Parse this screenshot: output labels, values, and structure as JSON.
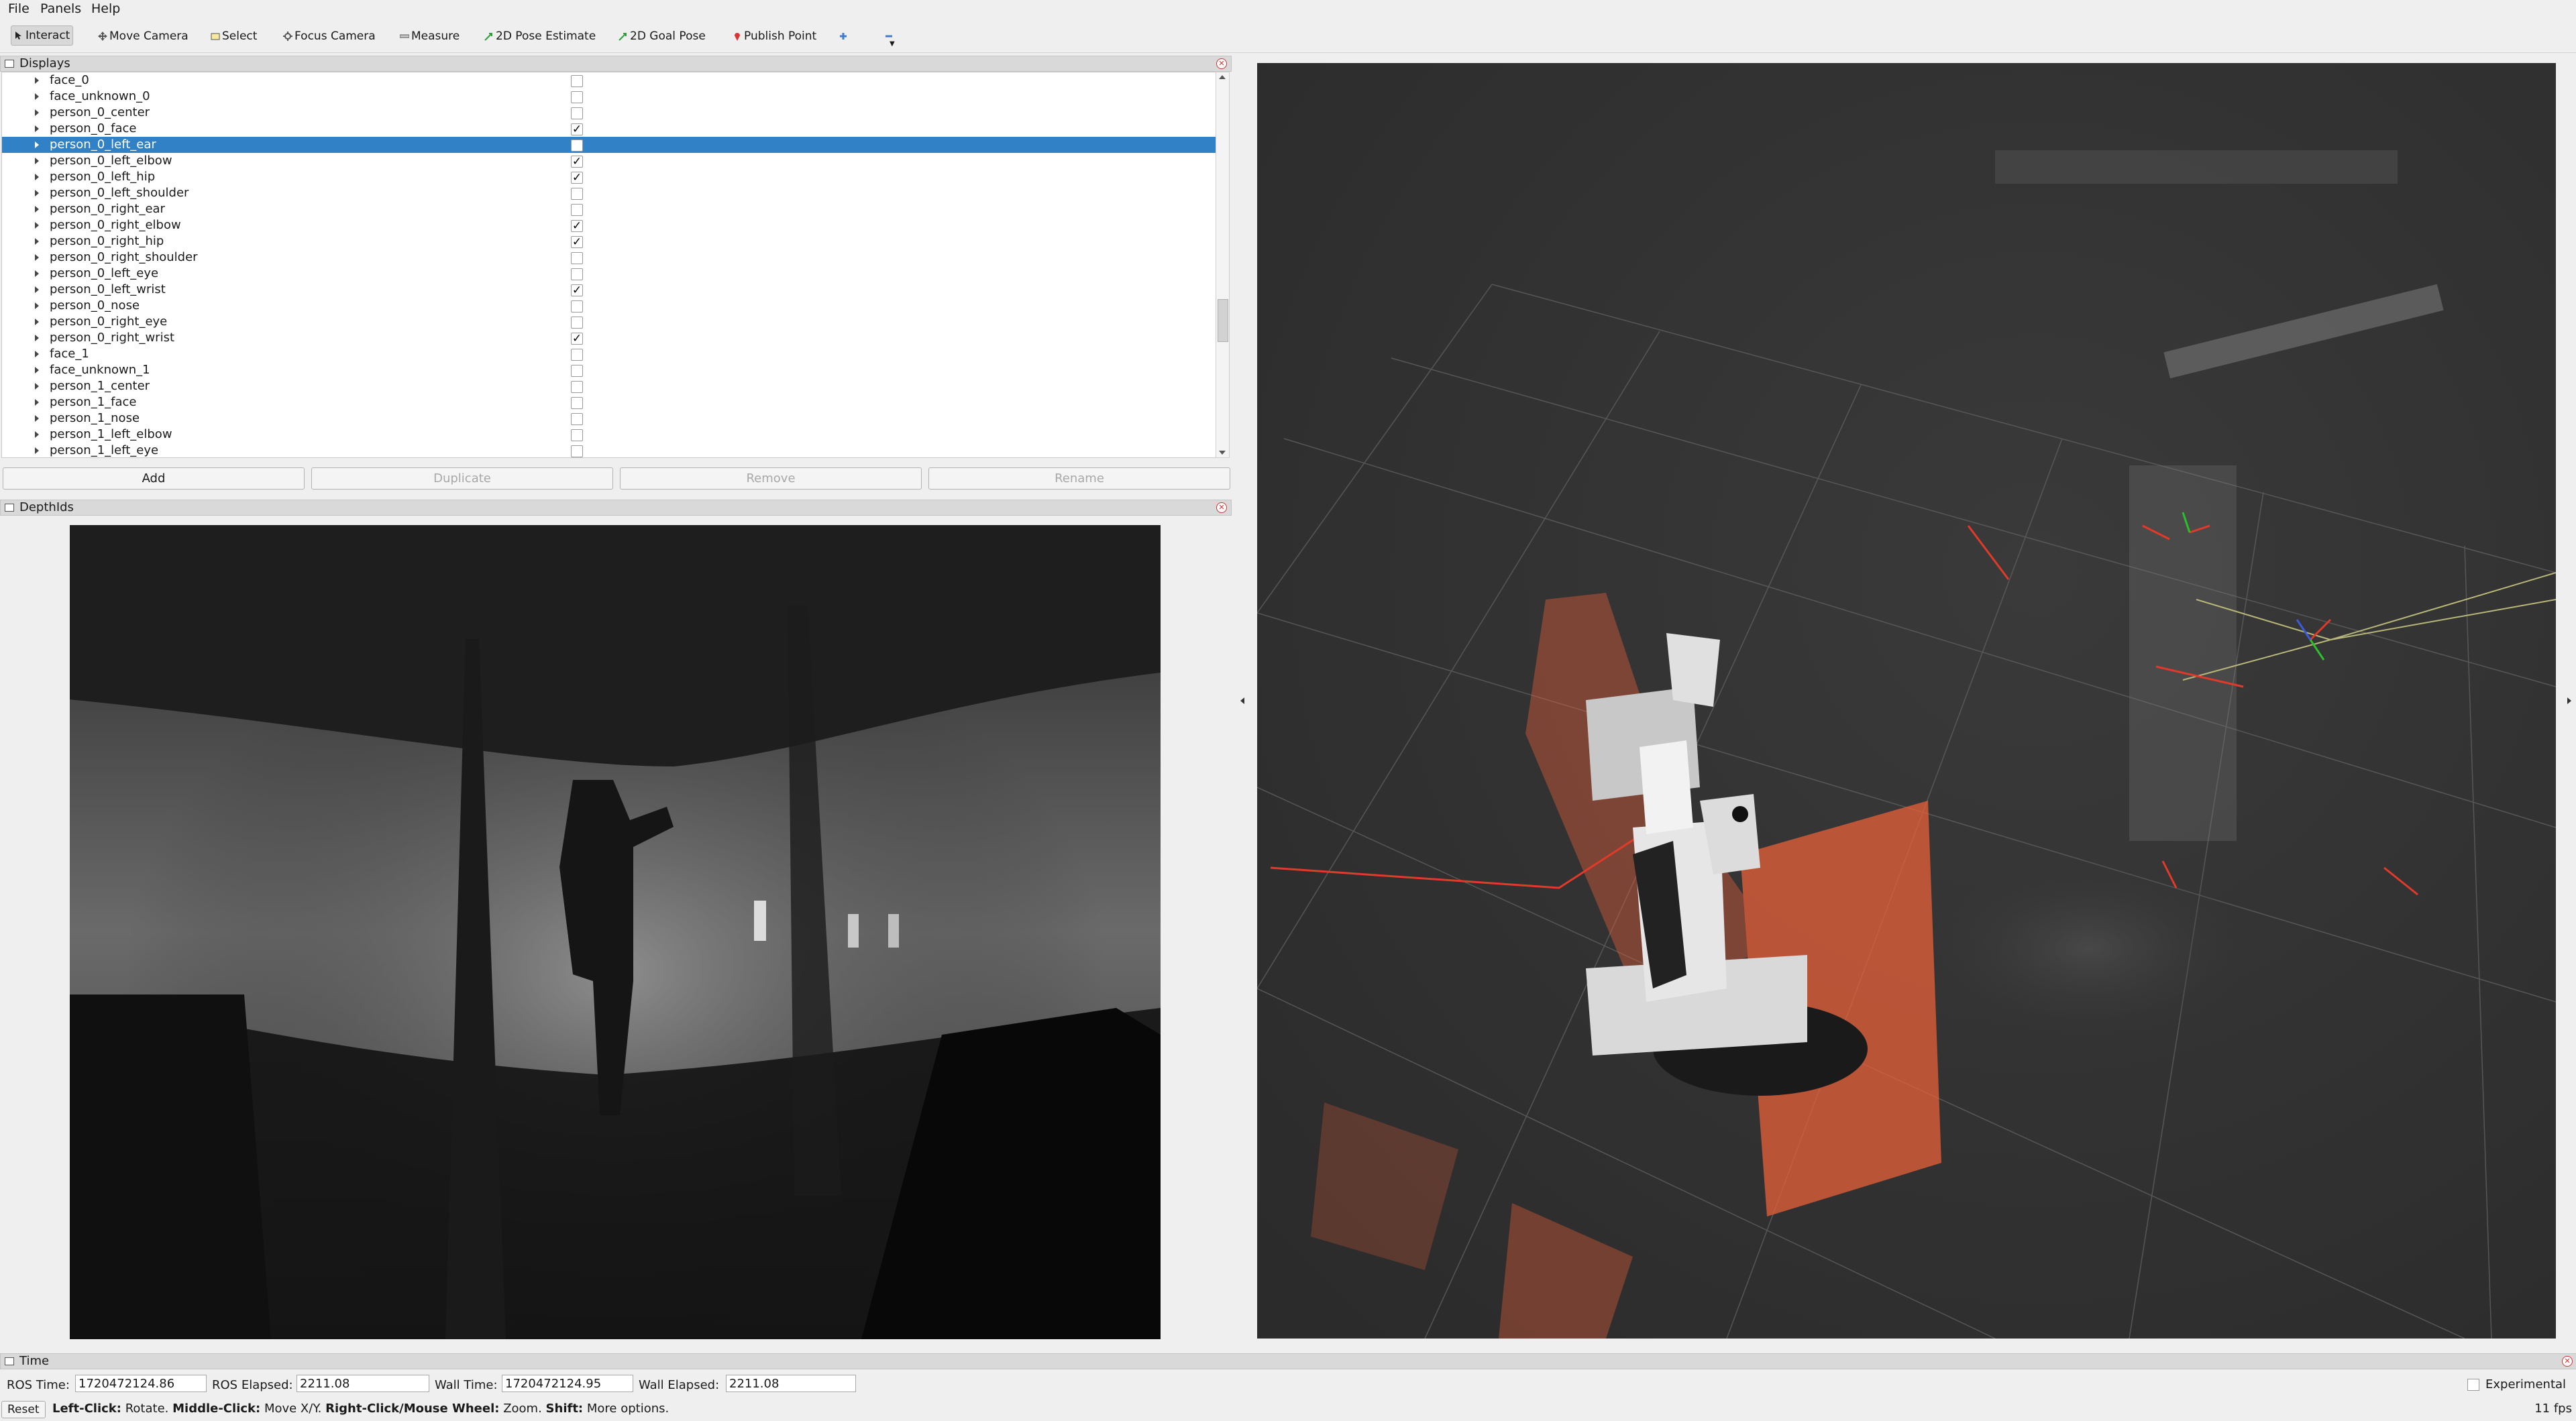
{
  "menu": [
    {
      "label": "File"
    },
    {
      "label": "Panels"
    },
    {
      "label": "Help"
    }
  ],
  "toolbar": {
    "tools": [
      {
        "label": "Interact",
        "icon": "cursor-icon",
        "active": true
      },
      {
        "label": "Move Camera",
        "icon": "move-camera-icon"
      },
      {
        "label": "Select",
        "icon": "select-box-icon"
      },
      {
        "label": "Focus Camera",
        "icon": "focus-camera-icon"
      },
      {
        "label": "Measure",
        "icon": "ruler-icon"
      },
      {
        "label": "2D Pose Estimate",
        "icon": "pose-arrow-icon"
      },
      {
        "label": "2D Goal Pose",
        "icon": "goal-arrow-icon"
      },
      {
        "label": "Publish Point",
        "icon": "map-pin-icon"
      }
    ],
    "add_tool_icon": "plus-icon",
    "remove_tool_icon": "minus-icon"
  },
  "displays_panel": {
    "title": "Displays",
    "selected_index": 4,
    "items": [
      {
        "label": "face_0",
        "checked": false
      },
      {
        "label": "face_unknown_0",
        "checked": false
      },
      {
        "label": "person_0_center",
        "checked": false
      },
      {
        "label": "person_0_face",
        "checked": true
      },
      {
        "label": "person_0_left_ear",
        "checked": false
      },
      {
        "label": "person_0_left_elbow",
        "checked": true
      },
      {
        "label": "person_0_left_hip",
        "checked": true
      },
      {
        "label": "person_0_left_shoulder",
        "checked": false
      },
      {
        "label": "person_0_right_ear",
        "checked": false
      },
      {
        "label": "person_0_right_elbow",
        "checked": true
      },
      {
        "label": "person_0_right_hip",
        "checked": true
      },
      {
        "label": "person_0_right_shoulder",
        "checked": false
      },
      {
        "label": "person_0_left_eye",
        "checked": false
      },
      {
        "label": "person_0_left_wrist",
        "checked": true
      },
      {
        "label": "person_0_nose",
        "checked": false
      },
      {
        "label": "person_0_right_eye",
        "checked": false
      },
      {
        "label": "person_0_right_wrist",
        "checked": true
      },
      {
        "label": "face_1",
        "checked": false
      },
      {
        "label": "face_unknown_1",
        "checked": false
      },
      {
        "label": "person_1_center",
        "checked": false
      },
      {
        "label": "person_1_face",
        "checked": false
      },
      {
        "label": "person_1_nose",
        "checked": false
      },
      {
        "label": "person_1_left_elbow",
        "checked": false
      },
      {
        "label": "person_1_left_eye",
        "checked": false
      }
    ],
    "buttons": {
      "add": "Add",
      "duplicate": "Duplicate",
      "remove": "Remove",
      "rename": "Rename"
    }
  },
  "depth_panel": {
    "title": "DepthIds"
  },
  "time_panel": {
    "title": "Time",
    "ros_time_label": "ROS Time:",
    "ros_time": "1720472124.86",
    "ros_elapsed_label": "ROS Elapsed:",
    "ros_elapsed": "2211.08",
    "wall_time_label": "Wall Time:",
    "wall_time": "1720472124.95",
    "wall_elapsed_label": "Wall Elapsed:",
    "wall_elapsed": "2211.08",
    "experimental_label": "Experimental"
  },
  "status": {
    "reset_label": "Reset",
    "hint_left_click": "Left-Click:",
    "hint_left_click_text": "Rotate.",
    "hint_middle_click": "Middle-Click:",
    "hint_middle_click_text": "Move X/Y.",
    "hint_right_click": "Right-Click/Mouse Wheel:",
    "hint_right_click_text": "Zoom.",
    "hint_shift": "Shift:",
    "hint_shift_text": "More options.",
    "fps": "11 fps"
  },
  "colors": {
    "selection": "#3181c6",
    "viewport_bg": "#303030",
    "laser": "#e04a2a",
    "pointcloud_orange": "#e8603a"
  }
}
